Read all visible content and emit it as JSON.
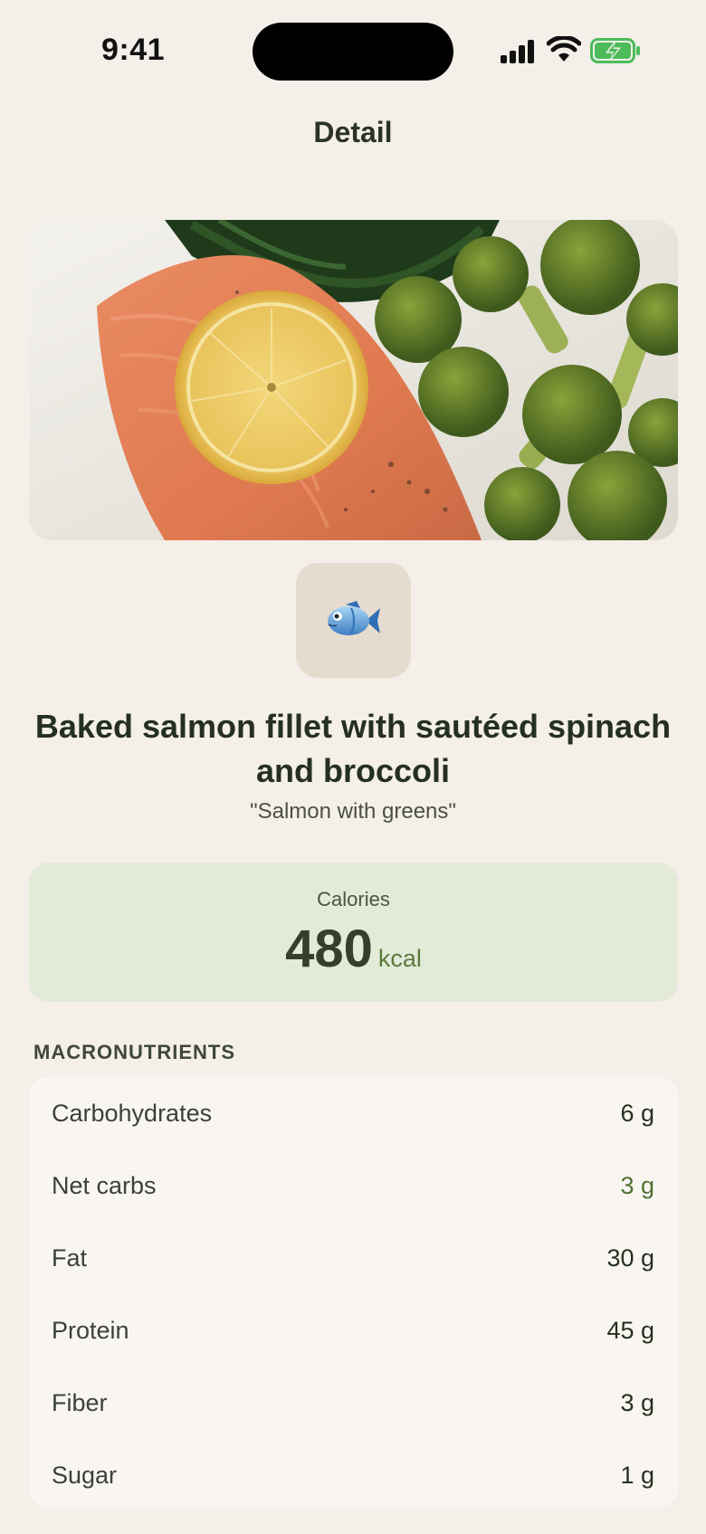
{
  "status_bar": {
    "time": "9:41"
  },
  "nav": {
    "title": "Detail"
  },
  "meal": {
    "emoji": "🐟",
    "title": "Baked salmon fillet with sautéed spinach and broccoli",
    "nickname": "\"Salmon with greens\""
  },
  "calories": {
    "label": "Calories",
    "value": "480",
    "unit": "kcal"
  },
  "macros": {
    "header": "MACRONUTRIENTS",
    "rows": [
      {
        "label": "Carbohydrates",
        "value": "6 g"
      },
      {
        "label": "Net carbs",
        "value": "3 g"
      },
      {
        "label": "Fat",
        "value": "30 g"
      },
      {
        "label": "Protein",
        "value": "45 g"
      },
      {
        "label": "Fiber",
        "value": "3 g"
      },
      {
        "label": "Sugar",
        "value": "1 g"
      }
    ]
  },
  "colors": {
    "background": "#f4efe9",
    "calorie_card": "#e3ead8",
    "accent_green": "#4f7233",
    "tile": "#e6dbcf"
  }
}
